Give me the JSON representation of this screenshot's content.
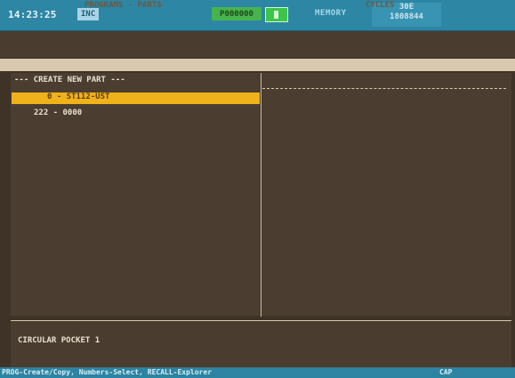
{
  "header": {
    "time": "14:23:25",
    "mode_badge": "INC",
    "program": "P000000",
    "memory_label": "MEMORY",
    "counter_top": "30E",
    "counter_bottom": "1808844"
  },
  "columns": {
    "left": "PROGRAMS - PARTS",
    "right": "CYCLES"
  },
  "programs": [
    {
      "label": "--- CREATE NEW PART ---",
      "selected": false
    },
    {
      "label": "0 - ST112-UST",
      "selected": true
    },
    {
      "label": "222 - 0000",
      "selected": false
    }
  ],
  "details": {
    "title": "CIRCULAR POCKET 1"
  },
  "footer": {
    "hint": "PROG-Create/Copy, Numbers-Select, RECALL-Explorer",
    "caps": "CAP"
  }
}
